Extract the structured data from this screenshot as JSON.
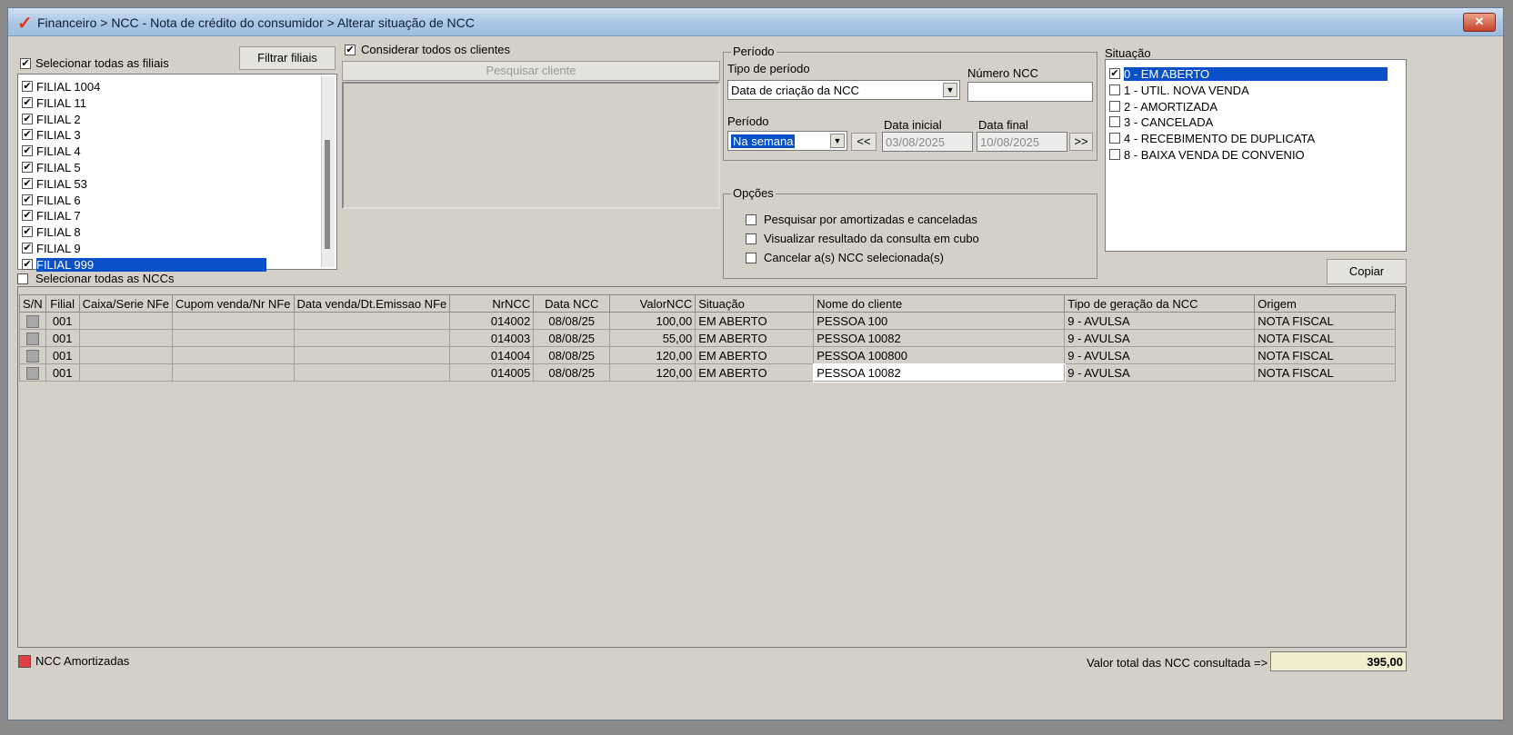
{
  "window": {
    "title": "Financeiro > NCC - Nota de crédito do consumidor > Alterar situação de NCC",
    "close_label": "✕"
  },
  "filiais": {
    "select_all_label": "Selecionar todas as filiais",
    "filter_button": "Filtrar filiais",
    "items": [
      {
        "label": "FILIAL 1004",
        "checked": true
      },
      {
        "label": "FILIAL 11",
        "checked": true
      },
      {
        "label": "FILIAL 2",
        "checked": true
      },
      {
        "label": "FILIAL 3",
        "checked": true
      },
      {
        "label": "FILIAL 4",
        "checked": true
      },
      {
        "label": "FILIAL 5",
        "checked": true
      },
      {
        "label": "FILIAL 53",
        "checked": true
      },
      {
        "label": "FILIAL 6",
        "checked": true
      },
      {
        "label": "FILIAL 7",
        "checked": true
      },
      {
        "label": "FILIAL 8",
        "checked": true
      },
      {
        "label": "FILIAL 9",
        "checked": true
      },
      {
        "label": "FILIAL 999",
        "checked": true,
        "selected": true
      }
    ]
  },
  "clientes": {
    "consider_all_label": "Considerar todos os clientes",
    "search_button": "Pesquisar cliente"
  },
  "periodo": {
    "legend": "Período",
    "tipo_label": "Tipo de período",
    "tipo_value": "Data de criação da NCC",
    "numero_label": "Número NCC",
    "numero_value": "",
    "periodo_label": "Período",
    "periodo_value": "Na semana",
    "prev_label": "<<",
    "next_label": ">>",
    "data_inicial_label": "Data inicial",
    "data_inicial_value": "03/08/2025",
    "data_final_label": "Data final",
    "data_final_value": "10/08/2025"
  },
  "opcoes": {
    "legend": "Opções",
    "items": [
      "Pesquisar por amortizadas e canceladas",
      "Visualizar resultado da consulta em cubo",
      "Cancelar a(s) NCC selecionada(s)"
    ]
  },
  "situacao": {
    "legend": "Situação",
    "items": [
      {
        "label": "0 - EM ABERTO",
        "checked": true,
        "selected": true
      },
      {
        "label": "1 - UTIL. NOVA VENDA",
        "checked": false
      },
      {
        "label": "2 - AMORTIZADA",
        "checked": false
      },
      {
        "label": "3 - CANCELADA",
        "checked": false
      },
      {
        "label": "4 - RECEBIMENTO DE DUPLICATA",
        "checked": false
      },
      {
        "label": "8 - BAIXA VENDA DE CONVENIO",
        "checked": false
      }
    ]
  },
  "copy_button": "Copiar",
  "select_all_ncc_label": "Selecionar todas as NCCs",
  "grid": {
    "columns": [
      "S/N",
      "Filial",
      "Caixa/Serie NFe",
      "Cupom venda/Nr NFe",
      "Data venda/Dt.Emissao NFe",
      "NrNCC",
      "Data NCC",
      "ValorNCC",
      "Situação",
      "Nome do cliente",
      "Tipo de geração da NCC",
      "Origem"
    ],
    "rows": [
      {
        "filial": "001",
        "caixa": "",
        "cupom": "",
        "data_venda": "",
        "nr": "014002",
        "data": "08/08/25",
        "valor": "100,00",
        "situacao": "EM ABERTO",
        "cliente": "PESSOA 100",
        "tipo": "9 - AVULSA",
        "origem": "NOTA FISCAL"
      },
      {
        "filial": "001",
        "caixa": "",
        "cupom": "",
        "data_venda": "",
        "nr": "014003",
        "data": "08/08/25",
        "valor": "55,00",
        "situacao": "EM ABERTO",
        "cliente": "PESSOA 10082",
        "tipo": "9 - AVULSA",
        "origem": "NOTA FISCAL"
      },
      {
        "filial": "001",
        "caixa": "",
        "cupom": "",
        "data_venda": "",
        "nr": "014004",
        "data": "08/08/25",
        "valor": "120,00",
        "situacao": "EM ABERTO",
        "cliente": "PESSOA 100800",
        "tipo": "9 - AVULSA",
        "origem": "NOTA FISCAL"
      },
      {
        "filial": "001",
        "caixa": "",
        "cupom": "",
        "data_venda": "",
        "nr": "014005",
        "data": "08/08/25",
        "valor": "120,00",
        "situacao": "EM ABERTO",
        "cliente": "PESSOA 10082",
        "tipo": "9 - AVULSA",
        "origem": "NOTA FISCAL",
        "editing_cliente": true
      }
    ]
  },
  "footer": {
    "legend_label": "NCC Amortizadas",
    "legend_color": "#e04040",
    "total_label": "Valor total das NCC consultada =>",
    "total_value": "395,00"
  }
}
